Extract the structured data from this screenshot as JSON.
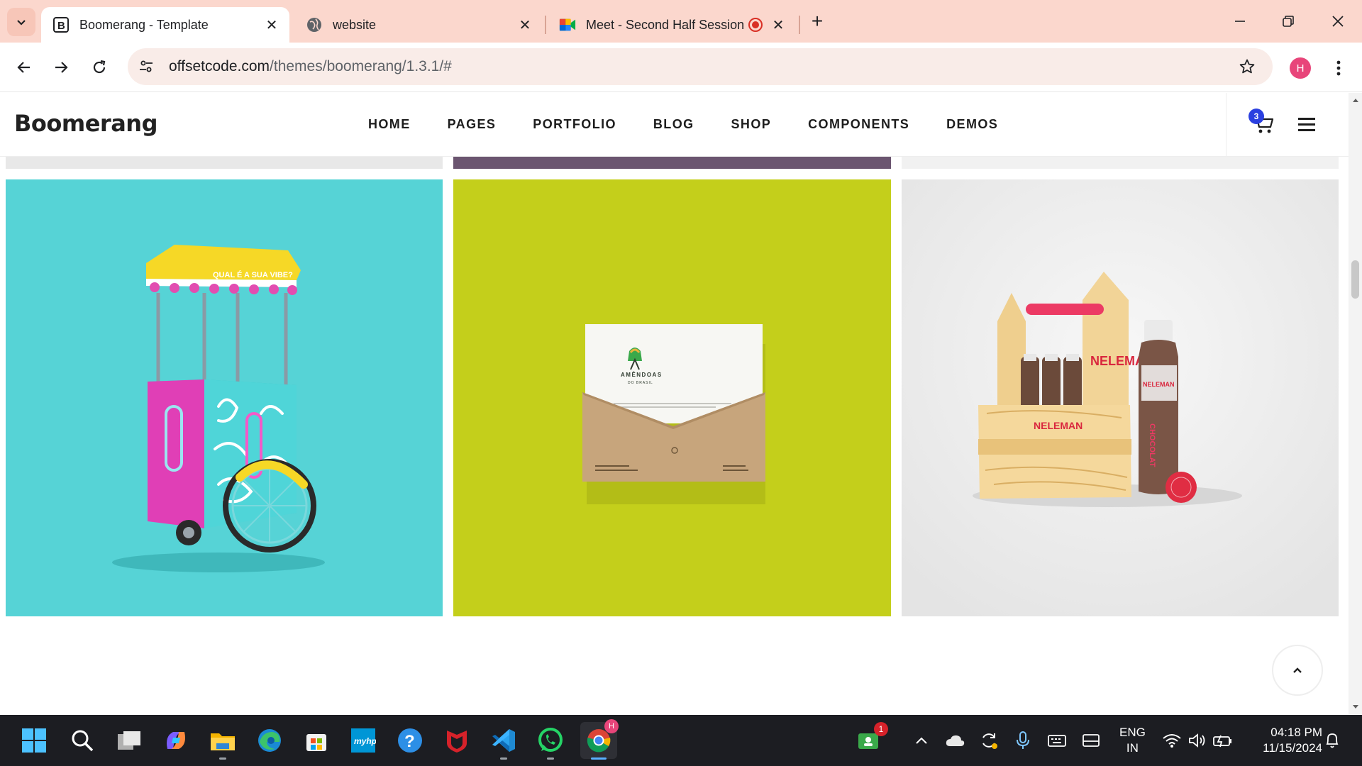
{
  "browser": {
    "tabs": [
      {
        "favicon": "b-logo-icon",
        "title": "Boomerang - Template",
        "active": true
      },
      {
        "favicon": "globe-icon",
        "title": "website",
        "active": false
      },
      {
        "favicon": "google-meet-icon",
        "title": "Meet - Second Half Session",
        "active": false,
        "recording": true
      }
    ],
    "url_domain": "offsetcode.com",
    "url_path": "/themes/boomerang/1.3.1/#",
    "profile_initial": "H"
  },
  "site": {
    "brand": "Boomerang",
    "nav": [
      "HOME",
      "PAGES",
      "PORTFOLIO",
      "BLOG",
      "SHOP",
      "COMPONENTS",
      "DEMOS"
    ],
    "cart_count": "3"
  },
  "gallery": {
    "tiles": [
      {
        "name": "ice-cream-cart",
        "bg": "#56d3d6",
        "cart_sign": "QUAL É A SUA VIBE?"
      },
      {
        "name": "amendoas-envelope",
        "bg": "#c4cf1b",
        "logo_text": "AMÊNDOAS",
        "logo_sub": "DO BRASIL"
      },
      {
        "name": "neleman-crate",
        "bg": "#eeeeee",
        "brand_text": "NELEMAN",
        "bottle_text": "CHOCOLAT"
      }
    ],
    "strip_colors": [
      "#e8e8e8",
      "#6b5570",
      "#f1f1f1"
    ]
  },
  "taskbar": {
    "notification_count": "1",
    "chrome_badge": "H",
    "lang_line1": "ENG",
    "lang_line2": "IN",
    "time": "04:18 PM",
    "date": "11/15/2024"
  }
}
